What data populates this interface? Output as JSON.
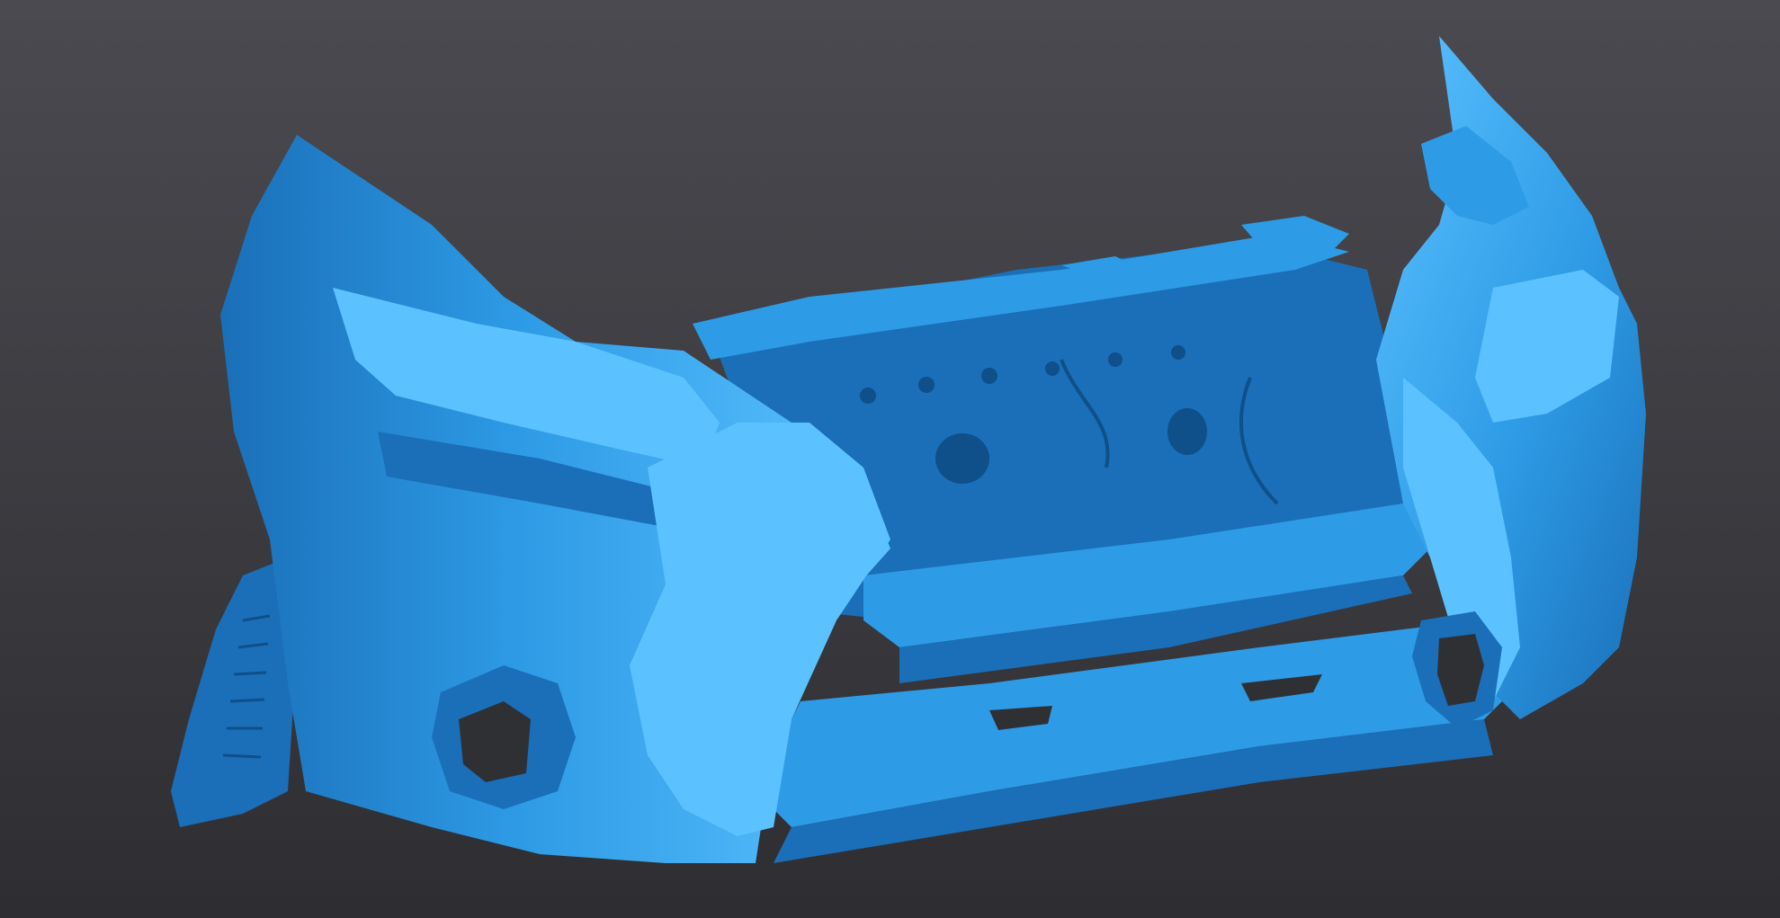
{
  "scene": {
    "subject": "scanned-front-bumper-mesh",
    "colors": {
      "background_top": "#4a4a50",
      "background_bottom": "#2e2e32",
      "mesh_base": "#2e9be6",
      "mesh_highlight": "#5cc2ff",
      "mesh_shadow": "#1a6fb8",
      "mesh_deep": "#0f4f8a",
      "hole": "#2f3034"
    }
  }
}
